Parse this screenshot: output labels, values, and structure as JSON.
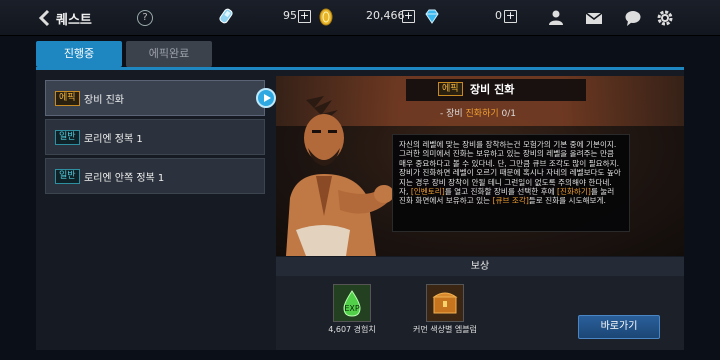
{
  "header": {
    "back_icon": "chevron-left-icon",
    "title": "퀘스트",
    "help": "?",
    "resources": [
      {
        "icon": "stamina-icon",
        "value": "95"
      },
      {
        "icon": "gold-coin-icon",
        "value": "20,466"
      },
      {
        "icon": "diamond-icon",
        "value": "0"
      }
    ],
    "plus": "+",
    "icons": [
      "friends-icon",
      "mail-icon",
      "chat-icon",
      "settings-icon"
    ]
  },
  "tabs": [
    {
      "label": "진행중",
      "active": true
    },
    {
      "label": "에픽완료",
      "active": false
    }
  ],
  "quests": [
    {
      "type": "에픽",
      "label": "장비 진화",
      "active": true
    },
    {
      "type": "일반",
      "label": "로리엔 정복 1",
      "active": false
    },
    {
      "type": "일반",
      "label": "로리엔 안쪽 정복 1",
      "active": false
    }
  ],
  "detail": {
    "badge": "에픽",
    "title": "장비 진화",
    "objective_prefix": "- 장비 ",
    "objective_highlight": "진화하기",
    "objective_progress": " 0/1",
    "desc_1": "자신의 레벨에 맞는 장비를 장착하는건 모험가의 기본 중에 기본이지. 그러한 의미에서 진화는 보유하고 있는 장비의 레벨을 올려주는 만큼 매우 중요하다고 볼 수 있다네. 단, 그만큼 큐브 조각도 많이 필요하지. 장비가 진화하면 레벨이 오르기 때문에 혹시나 자네의 레벨보다도 높아지는 경우 장비 장착이 안될 테니 그런일이 없도록 주의해야 한다네. 자, ",
    "desc_hl_1": "[인벤토리]",
    "desc_2": "를 열고 진화할 장비를 선택한 후에 ",
    "desc_hl_2": "[진화하기]",
    "desc_3": "를 눌러 진화 화면에서 보유하고 있는 ",
    "desc_hl_3": "[큐브 조각]",
    "desc_4": "들로 진화를 시도해보게."
  },
  "reward": {
    "heading": "보상",
    "items": [
      {
        "icon": "exp-potion-icon",
        "label": "4,607 경험치"
      },
      {
        "icon": "treasure-chest-icon",
        "label": "커먼 색상별 엠블럼"
      }
    ],
    "go_button": "바로가기"
  },
  "colors": {
    "accent": "#1e87c2",
    "epic": "#f0b43c",
    "normal": "#50c8d8",
    "highlight": "#f0a030"
  }
}
